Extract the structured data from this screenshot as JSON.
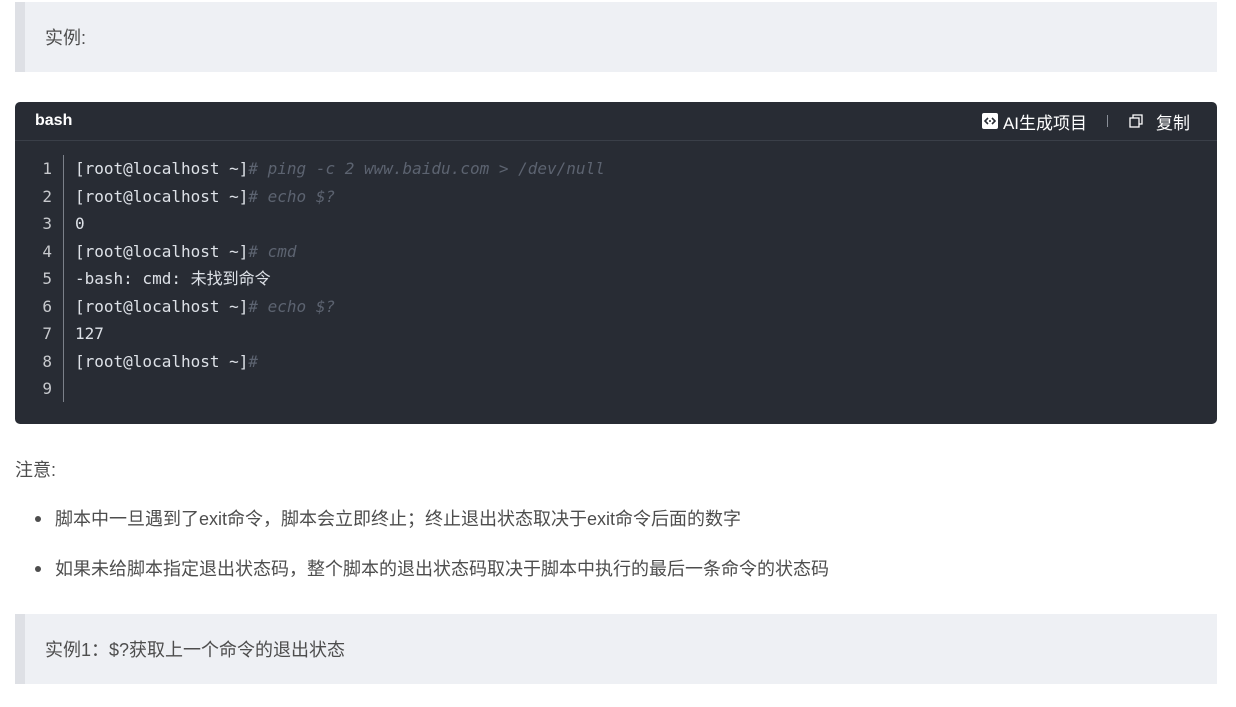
{
  "quote_top": {
    "text": "实例:"
  },
  "code_block": {
    "language": "bash",
    "ai_button": "AI生成项目",
    "copy_button": "复制",
    "lines": [
      {
        "num": "1",
        "prompt": "[root@localhost ~]",
        "comment": "# ping -c 2 www.baidu.com > /dev/null"
      },
      {
        "num": "2",
        "prompt": "[root@localhost ~]",
        "comment": "# echo $?"
      },
      {
        "num": "3",
        "prompt": "0",
        "comment": ""
      },
      {
        "num": "4",
        "prompt": "[root@localhost ~]",
        "comment": "# cmd"
      },
      {
        "num": "5",
        "prompt": "-bash: cmd: 未找到命令",
        "comment": ""
      },
      {
        "num": "6",
        "prompt": "[root@localhost ~]",
        "comment": "# echo $?"
      },
      {
        "num": "7",
        "prompt": "127",
        "comment": ""
      },
      {
        "num": "8",
        "prompt": "[root@localhost ~]",
        "comment": "#"
      },
      {
        "num": "9",
        "prompt": "",
        "comment": ""
      }
    ]
  },
  "note": {
    "label": "注意:"
  },
  "bullets": [
    "脚本中一旦遇到了exit命令，脚本会立即终止；终止退出状态取决于exit命令后面的数字",
    "如果未给脚本指定退出状态码，整个脚本的退出状态码取决于脚本中执行的最后一条命令的状态码"
  ],
  "quote_bottom": {
    "text": "实例1：$?获取上一个命令的退出状态"
  },
  "colors": {
    "code_bg": "#282c34",
    "comment": "#5c6370",
    "quote_bg": "#eef0f4",
    "quote_border": "#dee0e5"
  },
  "icons": {
    "ai": "code-icon",
    "copy": "copy-icon"
  }
}
